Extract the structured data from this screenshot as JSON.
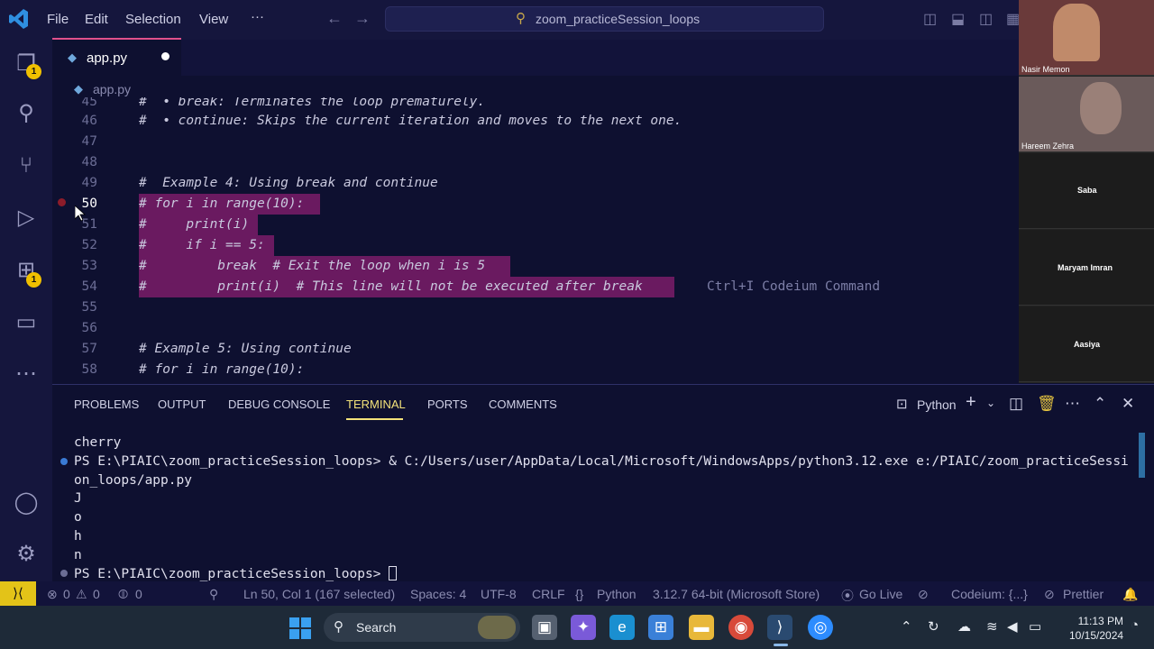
{
  "menu": {
    "file": "File",
    "edit": "Edit",
    "selection": "Selection",
    "view": "View",
    "more": "···"
  },
  "search": {
    "text": "zoom_practiceSession_loops"
  },
  "activity": {
    "explorer_badge": "1",
    "extensions_badge": "1"
  },
  "tab": {
    "label": "app.py"
  },
  "breadcrumb": {
    "file": "app.py"
  },
  "editor": {
    "lines": [
      {
        "num": "45",
        "code": "#  • break: Terminates the loop prematurely."
      },
      {
        "num": "46",
        "code": "#  • continue: Skips the current iteration and moves to the next one."
      },
      {
        "num": "47",
        "code": ""
      },
      {
        "num": "48",
        "code": ""
      },
      {
        "num": "49",
        "code": "#  Example 4: Using break and continue"
      },
      {
        "num": "50",
        "code": "# for i in range(10):"
      },
      {
        "num": "51",
        "code": "#     print(i)"
      },
      {
        "num": "52",
        "code": "#     if i == 5:"
      },
      {
        "num": "53",
        "code": "#         break  # Exit the loop when i is 5"
      },
      {
        "num": "54",
        "code": "#         print(i)  # This line will not be executed after break"
      },
      {
        "num": "55",
        "code": ""
      },
      {
        "num": "56",
        "code": ""
      },
      {
        "num": "57",
        "code": "# Example 5: Using continue"
      },
      {
        "num": "58",
        "code": "# for i in range(10):"
      }
    ],
    "hint": "Ctrl+I Codeium Command"
  },
  "panel": {
    "tabs": [
      "PROBLEMS",
      "OUTPUT",
      "DEBUG CONSOLE",
      "TERMINAL",
      "PORTS",
      "COMMENTS"
    ],
    "terminal_kind": "Python",
    "terminal": {
      "l1": "cherry",
      "l2": "PS E:\\PIAIC\\zoom_practiceSession_loops> & C:/Users/user/AppData/Local/Microsoft/WindowsApps/python3.12.exe e:/PIAIC/zoom_practiceSessi",
      "l3": "on_loops/app.py",
      "l4": "J",
      "l5": "o",
      "l6": "h",
      "l7": "n",
      "l8": "PS E:\\PIAIC\\zoom_practiceSession_loops> "
    }
  },
  "status": {
    "errors": "0",
    "warnings": "0",
    "ports": "0",
    "position": "Ln 50, Col 1 (167 selected)",
    "spaces": "Spaces: 4",
    "encoding": "UTF-8",
    "eol": "CRLF",
    "language": "Python",
    "interpreter": "3.12.7 64-bit (Microsoft Store)",
    "golive": "Go Live",
    "codeium": "Codeium: {...}",
    "prettier": "Prettier"
  },
  "taskbar": {
    "search": "Search",
    "time": "11:13 PM",
    "date": "10/15/2024"
  },
  "participants": [
    "Nasir Memon",
    "Hareem Zehra",
    "Saba",
    "Maryam Imran",
    "Aasiya"
  ],
  "colors": {
    "accent": "#e0508c",
    "selection": "#6a1a60",
    "badge": "#f0c000",
    "terminal_tab": "#f3e27a"
  }
}
